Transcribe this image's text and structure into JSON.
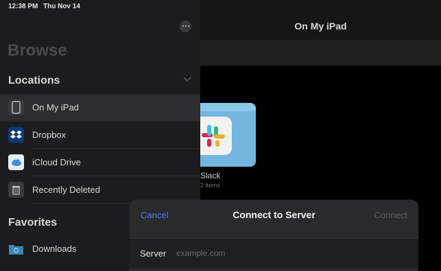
{
  "status_bar": {
    "time": "12:38 PM",
    "date": "Thu Nov 14"
  },
  "main": {
    "title": "On My iPad",
    "folder": {
      "name": "Slack",
      "item_count": "2 items"
    }
  },
  "sidebar": {
    "browse_title": "Browse",
    "locations_title": "Locations",
    "locations": [
      {
        "label": "On My iPad",
        "icon": "ipad-icon",
        "selected": true
      },
      {
        "label": "Dropbox",
        "icon": "dropbox-icon",
        "selected": false
      },
      {
        "label": "iCloud Drive",
        "icon": "icloud-icon",
        "selected": false
      },
      {
        "label": "Recently Deleted",
        "icon": "trash-icon",
        "selected": false
      }
    ],
    "favorites_title": "Favorites",
    "favorites": [
      {
        "label": "Downloads",
        "icon": "downloads-folder-icon"
      }
    ]
  },
  "modal": {
    "cancel_label": "Cancel",
    "title": "Connect to Server",
    "connect_label": "Connect",
    "server_label": "Server",
    "server_placeholder": "example.com",
    "server_value": ""
  },
  "colors": {
    "accent": "#3a82f7",
    "sidebar_bg": "#1c1c1e",
    "folder_blue": "#73b6e0"
  }
}
